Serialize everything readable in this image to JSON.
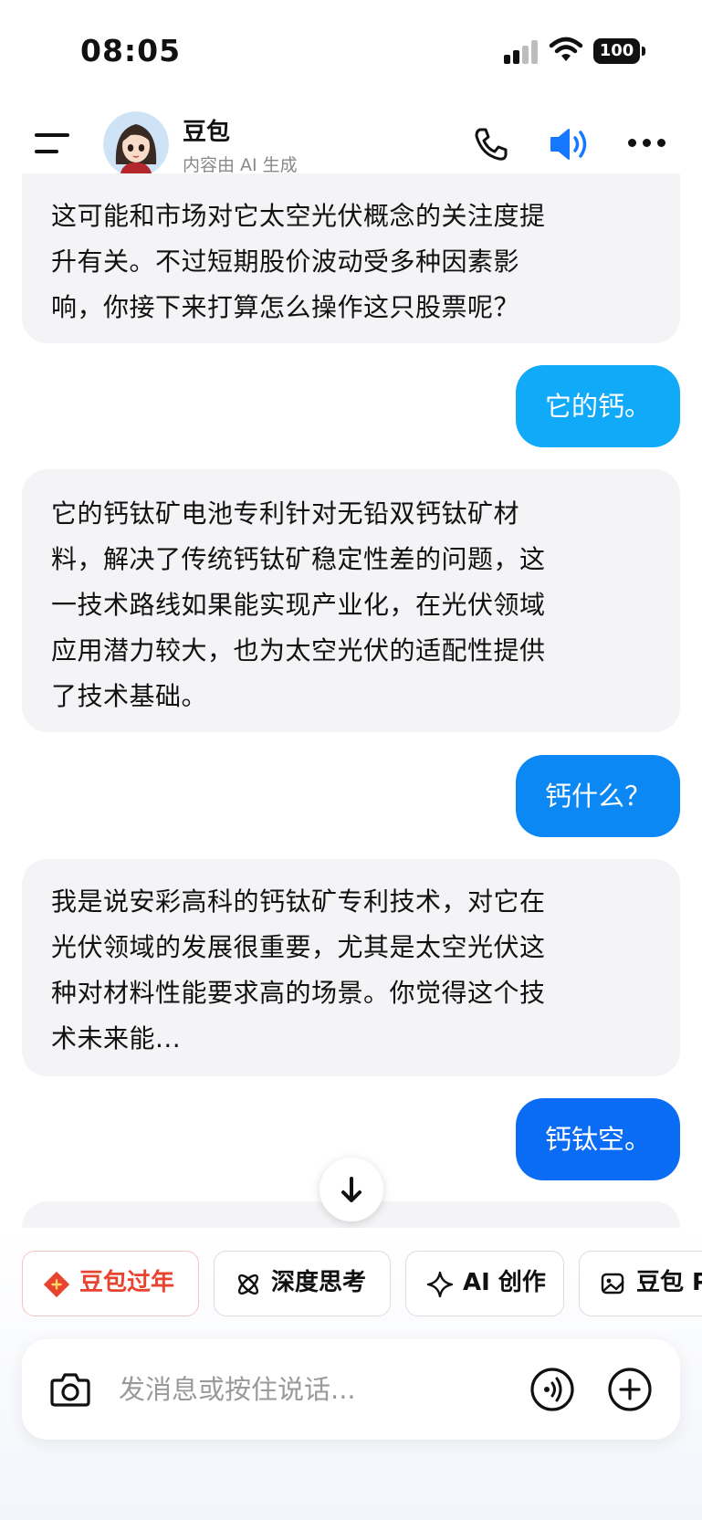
{
  "status_bar": {
    "time": "08:05",
    "battery": "100"
  },
  "header": {
    "bot_name": "豆包",
    "subtitle": "内容由 AI 生成"
  },
  "messages": [
    {
      "role": "ai",
      "lines": [
        "这可能和市场对它太空光伏概念的关注度提",
        "升有关。不过短期股价波动受多种因素影",
        "响，你接下来打算怎么操作这只股票呢？"
      ]
    },
    {
      "role": "user",
      "text": "它的钙。",
      "color": "#10aaf8"
    },
    {
      "role": "ai",
      "lines": [
        "它的钙钛矿电池专利针对无铅双钙钛矿材",
        "料，解决了传统钙钛矿稳定性差的问题，这",
        "一技术路线如果能实现产业化，在光伏领域",
        "应用潜力较大，也为太空光伏的适配性提供",
        "了技术基础。"
      ]
    },
    {
      "role": "user",
      "text": "钙什么？",
      "color": "#0b88f3"
    },
    {
      "role": "ai",
      "lines": [
        "我是说安彩高科的钙钛矿专利技术，对它在",
        "光伏领域的发展很重要，尤其是太空光伏这",
        "种对材料性能要求高的场景。你觉得这个技",
        "术未来能..."
      ]
    },
    {
      "role": "user",
      "text": "钙钛空。",
      "color": "#0a6cf5"
    }
  ],
  "chips": [
    {
      "label": "豆包过年",
      "icon": "fortune-icon",
      "color": "#e8432e"
    },
    {
      "label": "深度思考",
      "icon": "atom-icon",
      "color": "#111111"
    },
    {
      "label": "AI 创作",
      "icon": "sparkle-icon",
      "color": "#111111"
    },
    {
      "label": "豆包 P",
      "icon": "image-edit-icon",
      "color": "#111111"
    }
  ],
  "input": {
    "placeholder": "发消息或按住说话..."
  },
  "colors": {
    "accent": "#1677ff",
    "ai_bubble": "#f4f4f6"
  }
}
